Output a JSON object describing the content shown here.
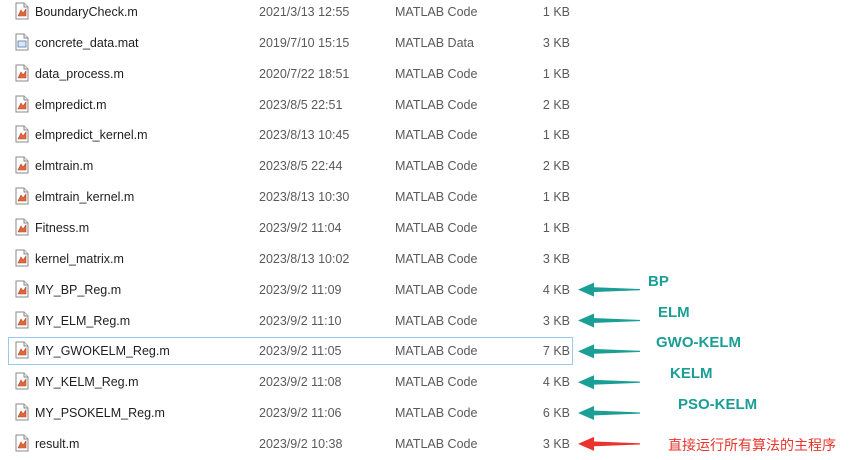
{
  "files": [
    {
      "name": "BoundaryCheck.m",
      "date": "2021/3/13 12:55",
      "type": "MATLAB Code",
      "size": "1 KB",
      "icon": "matlab-code-file-icon"
    },
    {
      "name": "concrete_data.mat",
      "date": "2019/7/10 15:15",
      "type": "MATLAB Data",
      "size": "3 KB",
      "icon": "matlab-data-file-icon"
    },
    {
      "name": "data_process.m",
      "date": "2020/7/22 18:51",
      "type": "MATLAB Code",
      "size": "1 KB",
      "icon": "matlab-code-file-icon"
    },
    {
      "name": "elmpredict.m",
      "date": "2023/8/5 22:51",
      "type": "MATLAB Code",
      "size": "2 KB",
      "icon": "matlab-code-file-icon"
    },
    {
      "name": "elmpredict_kernel.m",
      "date": "2023/8/13 10:45",
      "type": "MATLAB Code",
      "size": "1 KB",
      "icon": "matlab-code-file-icon"
    },
    {
      "name": "elmtrain.m",
      "date": "2023/8/5 22:44",
      "type": "MATLAB Code",
      "size": "2 KB",
      "icon": "matlab-code-file-icon"
    },
    {
      "name": "elmtrain_kernel.m",
      "date": "2023/8/13 10:30",
      "type": "MATLAB Code",
      "size": "1 KB",
      "icon": "matlab-code-file-icon"
    },
    {
      "name": "Fitness.m",
      "date": "2023/9/2 11:04",
      "type": "MATLAB Code",
      "size": "1 KB",
      "icon": "matlab-code-file-icon"
    },
    {
      "name": "kernel_matrix.m",
      "date": "2023/8/13 10:02",
      "type": "MATLAB Code",
      "size": "3 KB",
      "icon": "matlab-code-file-icon"
    },
    {
      "name": "MY_BP_Reg.m",
      "date": "2023/9/2 11:09",
      "type": "MATLAB Code",
      "size": "4 KB",
      "icon": "matlab-code-file-icon"
    },
    {
      "name": "MY_ELM_Reg.m",
      "date": "2023/9/2 11:10",
      "type": "MATLAB Code",
      "size": "3 KB",
      "icon": "matlab-code-file-icon"
    },
    {
      "name": "MY_GWOKELM_Reg.m",
      "date": "2023/9/2 11:05",
      "type": "MATLAB Code",
      "size": "7 KB",
      "icon": "matlab-code-file-icon",
      "selected": true
    },
    {
      "name": "MY_KELM_Reg.m",
      "date": "2023/9/2 11:08",
      "type": "MATLAB Code",
      "size": "4 KB",
      "icon": "matlab-code-file-icon"
    },
    {
      "name": "MY_PSOKELM_Reg.m",
      "date": "2023/9/2 11:06",
      "type": "MATLAB Code",
      "size": "6 KB",
      "icon": "matlab-code-file-icon"
    },
    {
      "name": "result.m",
      "date": "2023/9/2 10:38",
      "type": "MATLAB Code",
      "size": "3 KB",
      "icon": "matlab-code-file-icon"
    }
  ],
  "annotations": [
    {
      "label": "BP",
      "row": 9,
      "color": "#1a9e96"
    },
    {
      "label": "ELM",
      "row": 10,
      "color": "#1a9e96"
    },
    {
      "label": "GWO-KELM",
      "row": 11,
      "color": "#1a9e96"
    },
    {
      "label": "KELM",
      "row": 12,
      "color": "#1a9e96"
    },
    {
      "label": "PSO-KELM",
      "row": 13,
      "color": "#1a9e96"
    },
    {
      "label": "直接运行所有算法的主程序",
      "row": 14,
      "color": "#e8342c"
    }
  ]
}
